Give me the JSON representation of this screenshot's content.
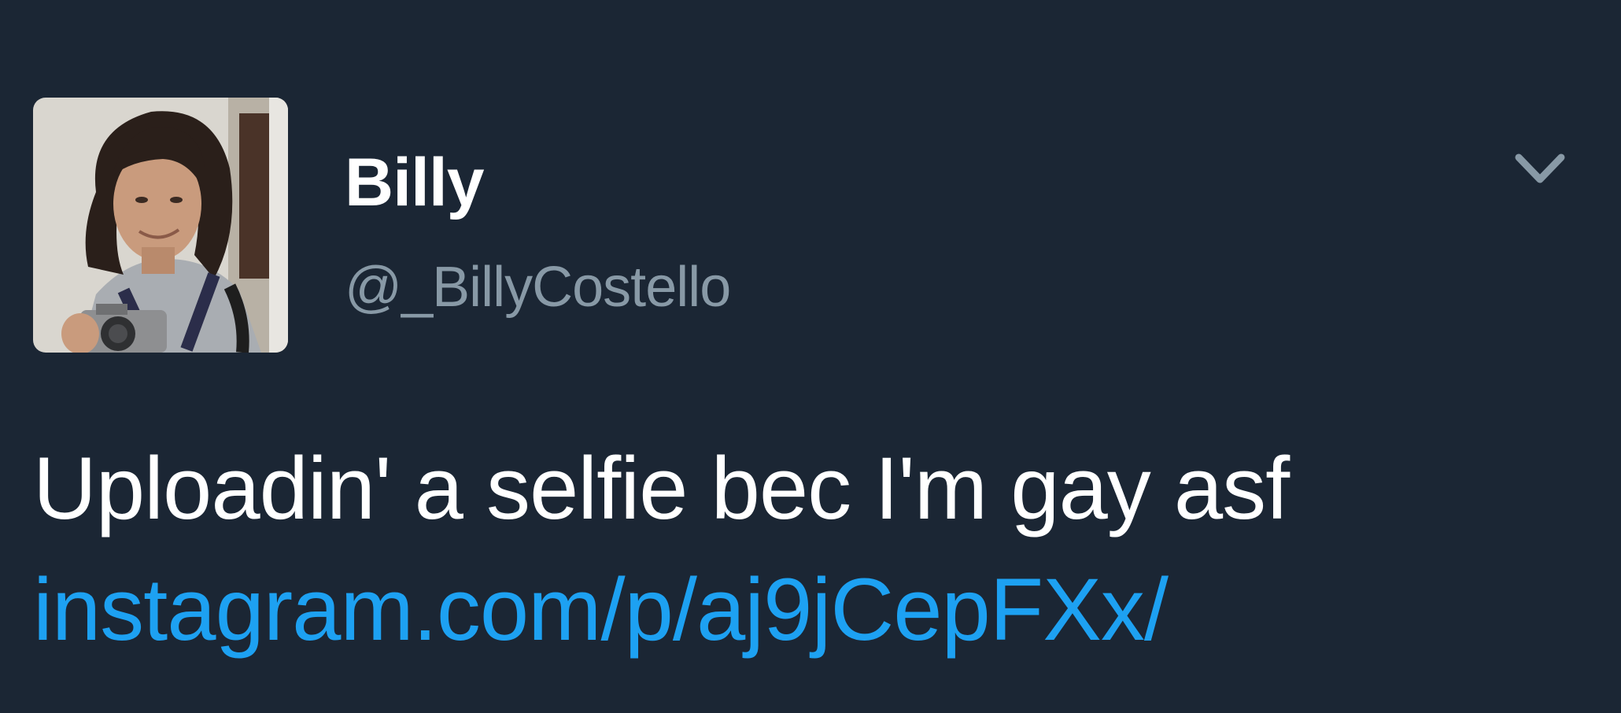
{
  "tweet": {
    "author": {
      "display_name": "Billy",
      "handle": "@_BillyCostello",
      "avatar_description": "profile photo"
    },
    "menu_icon": "chevron-down-icon",
    "text": "Uploadin' a selfie bec I'm gay asf",
    "link_text": "instagram.com/p/aj9jCepFXx/"
  },
  "colors": {
    "background": "#1b2634",
    "name": "#ffffff",
    "handle": "#8899a6",
    "text": "#ffffff",
    "link": "#1da1f2",
    "chevron": "#8899a6"
  }
}
